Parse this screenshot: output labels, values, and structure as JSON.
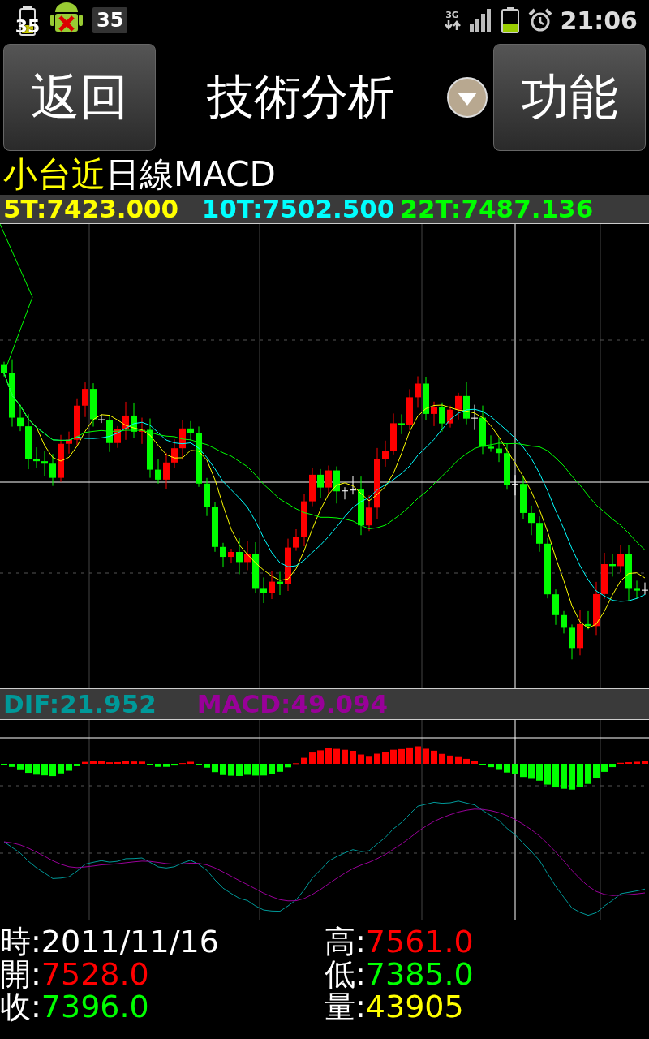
{
  "status_bar": {
    "battery_saver_badge": "35",
    "notification_count": "35",
    "network": "3G",
    "time": "21:06"
  },
  "header": {
    "back_button": "返回",
    "title": "技術分析",
    "menu_button": "功能"
  },
  "chart_title": {
    "symbol": "小台近",
    "period": "日線MACD"
  },
  "moving_averages": [
    {
      "label": "5T:7423.000",
      "color": "#ffff00"
    },
    {
      "label": "10T:7502.500",
      "color": "#00ffff"
    },
    {
      "label": "22T:7487.136",
      "color": "#00ff00"
    }
  ],
  "macd_legend": [
    {
      "label": "DIF:21.952",
      "color": "#009999"
    },
    {
      "label": "MACD:49.094",
      "color": "#990099"
    }
  ],
  "quote": [
    {
      "label": "時:",
      "value": "2011/11/16",
      "color": "#ffffff"
    },
    {
      "label": "高:",
      "value": "7561.0",
      "color": "#ff0000"
    },
    {
      "label": "開:",
      "value": "7528.0",
      "color": "#ff0000"
    },
    {
      "label": "低:",
      "value": "7385.0",
      "color": "#00ff00"
    },
    {
      "label": "收:",
      "value": "7396.0",
      "color": "#00ff00"
    },
    {
      "label": "量:",
      "value": "43905",
      "color": "#ffff00"
    }
  ]
}
